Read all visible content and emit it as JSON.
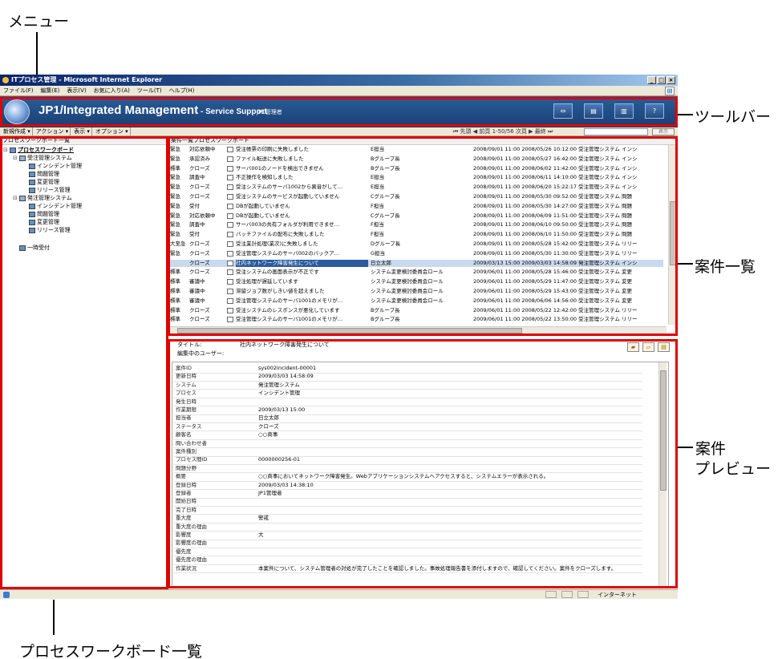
{
  "annotations": {
    "menu": "メニュー",
    "toolbar": "ツールバー",
    "case_list": "案件一覧",
    "case_preview_line1": "案件",
    "case_preview_line2": "プレビュー",
    "process_board_list": "プロセスワークボード一覧"
  },
  "window": {
    "title": "ITプロセス管理 - Microsoft Internet Explorer",
    "buttons": [
      "_",
      "□",
      "×"
    ]
  },
  "ie_menu": [
    "ファイル(F)",
    "編集(E)",
    "表示(V)",
    "お気に入り(A)",
    "ツール(T)",
    "ヘルプ(H)"
  ],
  "banner": {
    "product": "JP1/Integrated Management",
    "product_sub": " - Service Support",
    "user": "JP1管理者",
    "toolbar_icons": [
      "home-icon",
      "window-icon",
      "columns-icon",
      "help-icon"
    ],
    "help": "?"
  },
  "actionbar": {
    "menus": [
      "新規作成 ▾",
      "アクション ▾",
      "表示 ▾",
      "オプション ▾"
    ],
    "pager": "⏮ 先頭 ◀ 前頁 1-50/56 次頁 ▶ 最終 ⏭",
    "show_button": "表示"
  },
  "tree": {
    "title": "プロセスワークボード一覧",
    "nodes": [
      {
        "label": "プロセスワークボード",
        "level": 0,
        "type": "root",
        "exp": "⊟"
      },
      {
        "label": "受注管理システム",
        "level": 1,
        "type": "sys",
        "exp": "⊟"
      },
      {
        "label": "インシデント管理",
        "level": 2,
        "type": "board",
        "exp": ""
      },
      {
        "label": "問題管理",
        "level": 2,
        "type": "board",
        "exp": ""
      },
      {
        "label": "変更管理",
        "level": 2,
        "type": "board",
        "exp": ""
      },
      {
        "label": "リリース管理",
        "level": 2,
        "type": "board",
        "exp": ""
      },
      {
        "label": "発注管理システム",
        "level": 1,
        "type": "sys",
        "exp": "⊟"
      },
      {
        "label": "インシデント管理",
        "level": 2,
        "type": "board",
        "exp": ""
      },
      {
        "label": "問題管理",
        "level": 2,
        "type": "board",
        "exp": ""
      },
      {
        "label": "変更管理",
        "level": 2,
        "type": "board",
        "exp": ""
      },
      {
        "label": "リリース管理",
        "level": 2,
        "type": "board",
        "exp": ""
      },
      {
        "label": "一時受付",
        "level": 1,
        "type": "board",
        "exp": "",
        "gap": true
      }
    ]
  },
  "list": {
    "title": "案件一覧プロセスワークボード",
    "rows": [
      {
        "p": "緊急",
        "s": "対応依頼中",
        "t": "受注帳票の印刷に失敗しました",
        "a": "E担当",
        "r": "2008/09/01 11:00 2008/05/26 10:12:00 受注管理システム インシ"
      },
      {
        "p": "緊急",
        "s": "承認済み",
        "t": "ファイル転送に失敗しました",
        "a": "Bグループ長",
        "r": "2008/09/01 11:00 2008/05/27 16:42:00 受注管理システム インシ"
      },
      {
        "p": "標準",
        "s": "クローズ",
        "t": "サーバ001のノードを検出できません",
        "a": "Bグループ長",
        "r": "2008/09/01 11:00 2008/06/02 11:42:00 受注管理システム インシ"
      },
      {
        "p": "緊急",
        "s": "調査中",
        "t": "不正操作を検知しました",
        "a": "E担当",
        "r": "2008/09/01 11:00 2008/06/11 14:10:00 受注管理システム インシ"
      },
      {
        "p": "緊急",
        "s": "クローズ",
        "t": "受注システムのサーバ1002から異音がして…",
        "a": "E担当",
        "r": "2008/09/01 11:00 2008/06/20 15:22:17 受注管理システム インシ"
      },
      {
        "p": "緊急",
        "s": "クローズ",
        "t": "受注システムのサービスが起動していません",
        "a": "Cグループ長",
        "r": "2008/09/01 11:00 2008/05/30 09:52:00 受注管理システム 問題"
      },
      {
        "p": "緊急",
        "s": "受付",
        "t": "DBが起動していません",
        "a": "F担当",
        "r": "2008/09/01 11:00 2008/05/30 14:27:00 受注管理システム 問題"
      },
      {
        "p": "緊急",
        "s": "対応依頼中",
        "t": "DBが起動していません",
        "a": "Cグループ長",
        "r": "2008/09/01 11:00 2008/06/09 11:51:00 受注管理システム 問題"
      },
      {
        "p": "緊急",
        "s": "調査中",
        "t": "サーバ003の共有フォルダが利用できませ…",
        "a": "F担当",
        "r": "2008/09/01 11:00 2008/06/10 09:50:00 受注管理システム 問題"
      },
      {
        "p": "緊急",
        "s": "受付",
        "t": "バッチファイルの配布に失敗しました",
        "a": "F担当",
        "r": "2008/09/01 11:00 2008/06/10 11:50:00 受注管理システム 問題"
      },
      {
        "p": "大至急",
        "s": "クローズ",
        "t": "受注業計処理(業次)に失敗しました",
        "a": "Dグループ長",
        "r": "2008/09/01 11:00 2008/05/28 15:42:00 受注管理システム リリー"
      },
      {
        "p": "緊急",
        "s": "クローズ",
        "t": "受注管理システムのサーバ002のバックア…",
        "a": "G担当",
        "r": "2008/09/01 11:00 2008/05/30 11:30:00 受注管理システム リリー"
      },
      {
        "p": "",
        "s": "クローズ",
        "t": "社内ネットワーク障害発生について",
        "a": "日立太郎",
        "r": "2009/03/13 15:00 2009/03/03 14:58:09 発注管理システム インシ",
        "sel": true
      },
      {
        "p": "標準",
        "s": "クローズ",
        "t": "受注システムの画面表示が不正です",
        "a": "システム変更検討委員会ロール",
        "r": "2009/06/01 11:00 2008/05/28 15:46:00 受注管理システム 変更"
      },
      {
        "p": "標準",
        "s": "審議中",
        "t": "受注処理が遅延しています",
        "a": "システム変更検討委員会ロール",
        "r": "2009/06/01 11:00 2008/05/29 11:47:00 受注管理システム 変更"
      },
      {
        "p": "標準",
        "s": "審議中",
        "t": "滞留ジョブ数がしきい値を超えました",
        "a": "システム変更検討委員会ロール",
        "r": "2009/06/01 11:00 2008/05/29 15:43:00 受注管理システム 変更"
      },
      {
        "p": "標準",
        "s": "審議中",
        "t": "受注管理システムのサーバ1001のメモリが…",
        "a": "システム変更検討委員会ロール",
        "r": "2009/06/01 11:00 2008/06/06 14:56:00 受注管理システム 変更"
      },
      {
        "p": "標準",
        "s": "クローズ",
        "t": "受注システムのレスポンスが悪化しています",
        "a": "Bグループ長",
        "r": "2009/06/01 11:00 2008/05/22 12:42:00 受注管理システム リリー"
      },
      {
        "p": "標準",
        "s": "クローズ",
        "t": "受注管理システムのサーバ1001のメモリが…",
        "a": "Bグループ長",
        "r": "2009/06/01 11:00 2008/05/22 13:50:00 受注管理システム リリー"
      }
    ]
  },
  "preview": {
    "title_label": "タイトル:",
    "title_value": "社内ネットワーク障害発生について",
    "editing_label": "編集中のユーザー:",
    "fields": [
      {
        "k": "案件ID",
        "v": "sys002incident-00001"
      },
      {
        "k": "更新日時",
        "v": "2009/03/03 14:58:09"
      },
      {
        "k": "システム",
        "v": "発注管理システム"
      },
      {
        "k": "プロセス",
        "v": "インシデント管理"
      },
      {
        "k": "発生日時",
        "v": ""
      },
      {
        "k": "作業期限",
        "v": "2009/03/13 15:00"
      },
      {
        "k": "担当者",
        "v": "日立太郎"
      },
      {
        "k": "ステータス",
        "v": "クローズ"
      },
      {
        "k": "顧客名",
        "v": "○○商事"
      },
      {
        "k": "問い合わせ者",
        "v": ""
      },
      {
        "k": "案件種別",
        "v": ""
      },
      {
        "k": "プロセス間ID",
        "v": "0000000256-01"
      },
      {
        "k": "問題分野",
        "v": ""
      },
      {
        "k": "概要",
        "v": "○○商事においてネットワーク障害発生。Webアプリケーションシステムへアクセスすると、システムエラーが表示される。"
      },
      {
        "k": "登録日時",
        "v": "2009/03/03 14:38:10"
      },
      {
        "k": "登録者",
        "v": "JP1管理者"
      },
      {
        "k": "開始日時",
        "v": ""
      },
      {
        "k": "完了日時",
        "v": ""
      },
      {
        "k": "重大度",
        "v": "警戒"
      },
      {
        "k": "重大度の理由",
        "v": ""
      },
      {
        "k": "影響度",
        "v": "大"
      },
      {
        "k": "影響度の理由",
        "v": ""
      },
      {
        "k": "優先度",
        "v": ""
      },
      {
        "k": "優先度の理由",
        "v": ""
      },
      {
        "k": "作業状況",
        "v": "本案件について、システム管理者の対処が完了したことを確認しました。事故処理報告書を添付しますので、確認してください。案件をクローズします。"
      }
    ]
  },
  "status": {
    "zone": "インターネット"
  }
}
